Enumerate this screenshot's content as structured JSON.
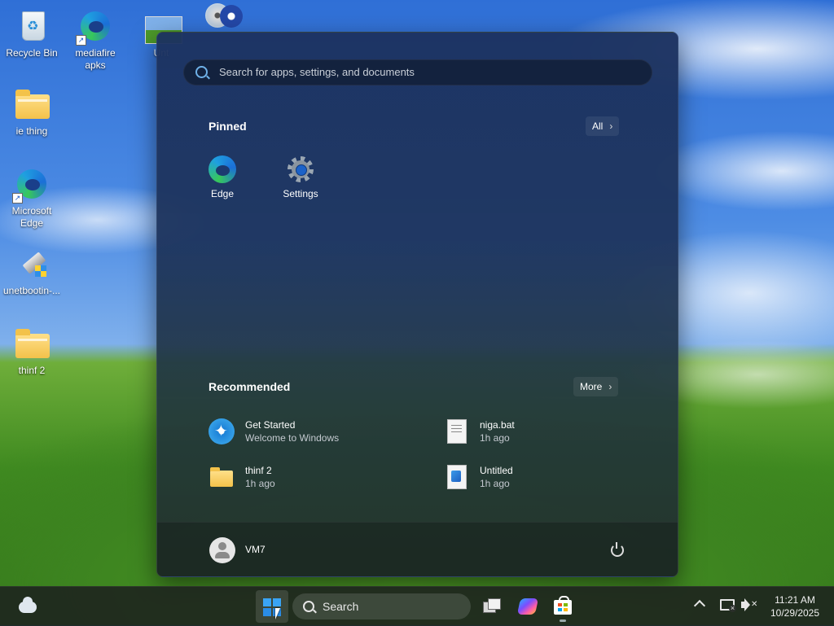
{
  "desktop": {
    "icons": [
      {
        "label": "Recycle Bin",
        "icon": "recycle-bin-icon"
      },
      {
        "label": "mediafire apks",
        "icon": "edge-shortcut-icon"
      },
      {
        "label": "Unt",
        "icon": "image-shortcut-icon"
      },
      {
        "label": "",
        "icon": "disc-burner-icon"
      },
      {
        "label": "ie thing",
        "icon": "folder-icon"
      },
      {
        "label": "Microsoft Edge",
        "icon": "edge-icon"
      },
      {
        "label": "unetbootin-...",
        "icon": "unetbootin-icon"
      },
      {
        "label": "thinf 2",
        "icon": "folder-icon"
      }
    ]
  },
  "start_menu": {
    "search_placeholder": "Search for apps, settings, and documents",
    "pinned": {
      "title": "Pinned",
      "all_label": "All",
      "apps": [
        {
          "label": "Edge",
          "icon": "edge-icon"
        },
        {
          "label": "Settings",
          "icon": "gear-icon"
        }
      ]
    },
    "recommended": {
      "title": "Recommended",
      "more_label": "More",
      "items": [
        {
          "title": "Get Started",
          "subtitle": "Welcome to Windows",
          "icon": "get-started-icon"
        },
        {
          "title": "niga.bat",
          "subtitle": "1h ago",
          "icon": "batch-file-icon"
        },
        {
          "title": "thinf 2",
          "subtitle": "1h ago",
          "icon": "folder-icon"
        },
        {
          "title": "Untitled",
          "subtitle": "1h ago",
          "icon": "image-file-icon"
        }
      ]
    },
    "user": {
      "name": "VM7"
    }
  },
  "taskbar": {
    "search_label": "Search",
    "time": "11:21 AM",
    "date": "10/29/2025",
    "accent": "#3aa4f5"
  }
}
